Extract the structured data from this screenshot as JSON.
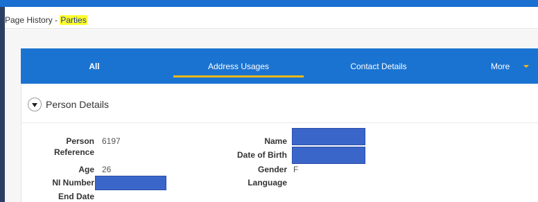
{
  "header": {
    "title_prefix": "Page History - ",
    "title_highlight": "Parties"
  },
  "tabs": [
    {
      "label": "All",
      "active": false
    },
    {
      "label": "Address Usages",
      "active": true
    },
    {
      "label": "Contact Details",
      "active": false
    },
    {
      "label": "More",
      "active": false
    }
  ],
  "section": {
    "title": "Person Details",
    "expanded": true
  },
  "fields": {
    "person_reference": {
      "label_line1": "Person",
      "label_line2": "Reference",
      "value": "6197"
    },
    "age": {
      "label": "Age",
      "value": "26"
    },
    "ni_number": {
      "label": "NI Number",
      "value": ""
    },
    "end_date": {
      "label": "End Date",
      "value": ""
    },
    "name": {
      "label": "Name",
      "value": ""
    },
    "date_of_birth": {
      "label": "Date of Birth",
      "value": ""
    },
    "gender": {
      "label": "Gender",
      "value": "F"
    },
    "language": {
      "label": "Language",
      "value": ""
    }
  },
  "colors": {
    "accent": "#1a73d1",
    "tab_underline": "#f2b817",
    "highlight": "#fffb2a",
    "redaction": "#3b66c9"
  }
}
